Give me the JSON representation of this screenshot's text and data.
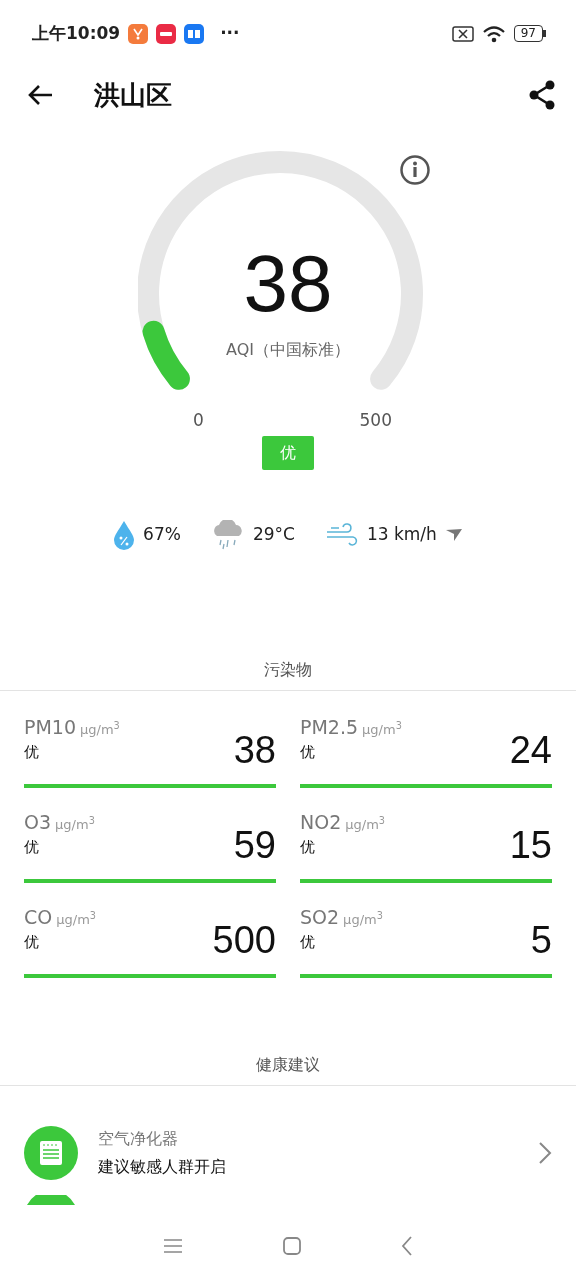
{
  "status_bar": {
    "time": "上午10:09",
    "more": "···",
    "battery": "97"
  },
  "header": {
    "title": "洪山区"
  },
  "gauge": {
    "value": "38",
    "label": "AQI（中国标准）",
    "min": "0",
    "max": "500",
    "grade": "优",
    "color": "#3cc83c"
  },
  "weather": {
    "humidity": "67%",
    "temperature": "29°C",
    "wind": "13 km/h"
  },
  "pollutants": {
    "title": "污染物",
    "items": [
      {
        "name": "PM10",
        "unit": "μg/m$^{3}$",
        "grade": "优",
        "value": "38",
        "color": "#3cc83c"
      },
      {
        "name": "PM2.5",
        "unit": "μg/m$^{3}$",
        "grade": "优",
        "value": "24",
        "color": "#3cc83c"
      },
      {
        "name": "O3",
        "unit": "μg/m$^{3}$",
        "grade": "优",
        "value": "59",
        "color": "#3cc83c"
      },
      {
        "name": "NO2",
        "unit": "μg/m$^{3}$",
        "grade": "优",
        "value": "15",
        "color": "#3cc83c"
      },
      {
        "name": "CO",
        "unit": "μg/m$^{3}$",
        "grade": "优",
        "value": "500",
        "color": "#3cc83c"
      },
      {
        "name": "SO2",
        "unit": "μg/m$^{3}$",
        "grade": "优",
        "value": "5",
        "color": "#3cc83c"
      }
    ]
  },
  "health": {
    "title": "健康建议",
    "items": [
      {
        "title": "空气净化器",
        "advice": "建议敏感人群开启"
      }
    ]
  }
}
